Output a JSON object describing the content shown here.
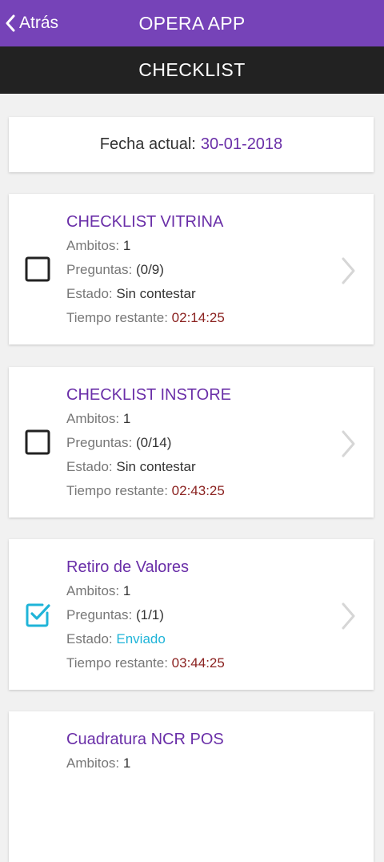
{
  "header": {
    "back_label": "Atrás",
    "app_title": "OPERA APP"
  },
  "subheader": {
    "title": "CHECKLIST"
  },
  "date": {
    "label": "Fecha actual:",
    "value": "30-01-2018"
  },
  "labels": {
    "ambitos": "Ambitos:",
    "preguntas": "Preguntas:",
    "estado": "Estado:",
    "tiempo": "Tiempo restante:"
  },
  "checklists": [
    {
      "title": "CHECKLIST VITRINA",
      "ambitos": "1",
      "preguntas": "(0/9)",
      "estado": "Sin contestar",
      "tiempo": "02:14:25",
      "checked": false
    },
    {
      "title": "CHECKLIST INSTORE",
      "ambitos": "1",
      "preguntas": "(0/14)",
      "estado": "Sin contestar",
      "tiempo": "02:43:25",
      "checked": false
    },
    {
      "title": "Retiro de Valores",
      "ambitos": "1",
      "preguntas": "(1/1)",
      "estado": "Enviado",
      "tiempo": "03:44:25",
      "checked": true
    },
    {
      "title": "Cuadratura NCR POS",
      "ambitos": "1"
    }
  ],
  "colors": {
    "primary": "#7643b8",
    "title_purple": "#6a2fa8",
    "subbar": "#222222",
    "time_red": "#8b2220",
    "sent_cyan": "#1fb4d8"
  },
  "icons": {
    "back": "chevron-left-icon",
    "unchecked": "checkbox-unchecked-icon",
    "checked": "checkbox-checked-icon",
    "open": "chevron-right-icon"
  }
}
